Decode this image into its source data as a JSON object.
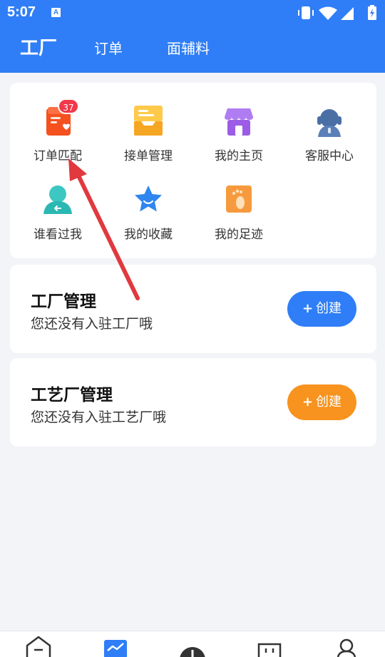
{
  "status_bar": {
    "time": "5:07",
    "badge": "A",
    "icons": [
      "vibrate-icon",
      "wifi-icon",
      "signal-icon",
      "battery-charging-icon"
    ]
  },
  "tabs": [
    {
      "label": "工厂",
      "active": true
    },
    {
      "label": "订单",
      "active": false
    },
    {
      "label": "面辅料",
      "active": false
    }
  ],
  "grid": [
    {
      "label": "订单匹配",
      "icon": "order-match-icon",
      "badge": "37"
    },
    {
      "label": "接单管理",
      "icon": "order-tray-icon"
    },
    {
      "label": "我的主页",
      "icon": "shop-icon"
    },
    {
      "label": "客服中心",
      "icon": "customer-service-icon"
    },
    {
      "label": "谁看过我",
      "icon": "visitor-icon"
    },
    {
      "label": "我的收藏",
      "icon": "favorite-star-icon"
    },
    {
      "label": "我的足迹",
      "icon": "footprint-icon"
    }
  ],
  "factory_mgmt": {
    "title": "工厂管理",
    "desc": "您还没有入驻工厂哦",
    "button_plus": "+",
    "button_label": "创建"
  },
  "craft_mgmt": {
    "title": "工艺厂管理",
    "desc": "您还没有入驻工艺厂哦",
    "button_plus": "+",
    "button_label": "创建"
  },
  "bottom_nav": [
    "home-icon",
    "chart-icon",
    "add-icon",
    "store-icon",
    "profile-icon"
  ],
  "colors": {
    "primary": "#2f7ef7",
    "orange": "#f7931e",
    "badge": "#f2384b",
    "annotation_arrow": "#e0393e"
  }
}
